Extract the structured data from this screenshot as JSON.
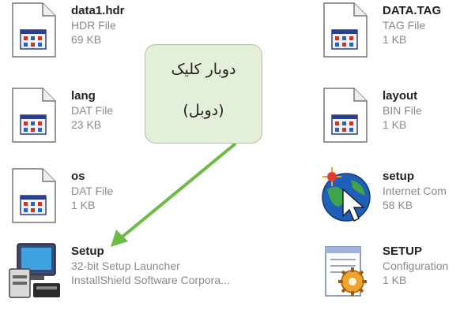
{
  "files": {
    "datahdr": {
      "name": "data1.hdr",
      "line1": "HDR File",
      "line2": "69 KB",
      "icon": "window-document-icon"
    },
    "lang": {
      "name": "lang",
      "line1": "DAT File",
      "line2": "23 KB",
      "icon": "window-document-icon"
    },
    "os": {
      "name": "os",
      "line1": "DAT File",
      "line2": "1 KB",
      "icon": "window-document-icon"
    },
    "setupexe": {
      "name": "Setup",
      "line1": "32-bit Setup Launcher",
      "line2": "InstallShield Software Corpora...",
      "icon": "installer-computer-icon"
    },
    "datatag": {
      "name": "DATA.TAG",
      "line1": "TAG File",
      "line2": "1 KB",
      "icon": "window-document-icon"
    },
    "layout": {
      "name": "layout",
      "line1": "BIN File",
      "line2": "1 KB",
      "icon": "window-document-icon"
    },
    "setupinet": {
      "name": "setup",
      "line1": "Internet Com",
      "line2": "58 KB",
      "icon": "globe-cursor-icon"
    },
    "setupini": {
      "name": "SETUP",
      "line1": "Configuration",
      "line2": "1 KB",
      "icon": "config-gear-icon"
    }
  },
  "callout": {
    "line1": "دوبار کلیک",
    "line2": "(دوبل)"
  },
  "colors": {
    "callout_bg": "#e3efd8",
    "arrow": "#6dbb45"
  }
}
